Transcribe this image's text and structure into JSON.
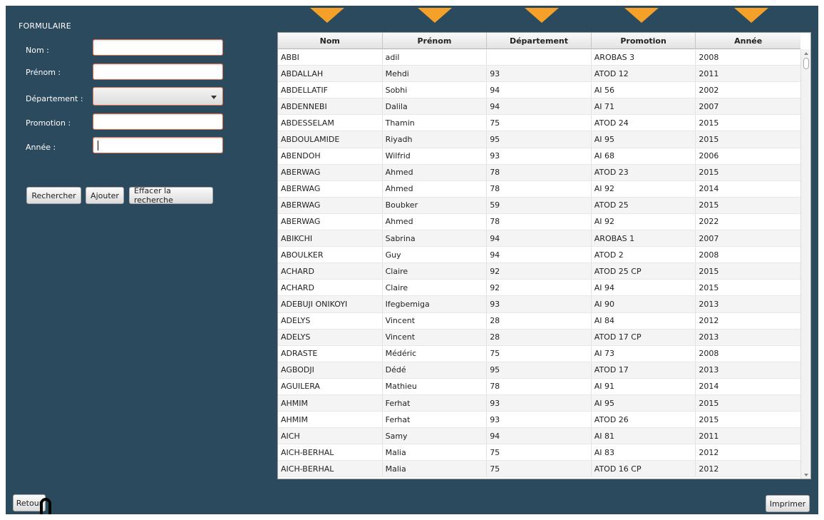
{
  "form": {
    "title": "FORMULAIRE",
    "nom_label": "Nom :",
    "prenom_label": "Prénom :",
    "departement_label": "Département :",
    "promotion_label": "Promotion :",
    "annee_label": "Année :",
    "nom_value": "",
    "prenom_value": "",
    "departement_value": "",
    "promotion_value": "",
    "annee_value": ""
  },
  "buttons": {
    "rechercher": "Rechercher",
    "ajouter": "Ajouter",
    "effacer": "Effacer la recherche",
    "retour": "Retour",
    "imprimer": "Imprimer"
  },
  "table": {
    "columns": [
      "Nom",
      "Prénom",
      "Département",
      "Promotion",
      "Année"
    ],
    "rows": [
      [
        "ABBI",
        "adil",
        "",
        "AROBAS 3",
        "2008"
      ],
      [
        "ABDALLAH",
        "Mehdi",
        "93",
        "ATOD 12",
        "2011"
      ],
      [
        "ABDELLATIF",
        "Sobhi",
        "94",
        "AI 56",
        "2002"
      ],
      [
        "ABDENNEBI",
        "Dalila",
        "94",
        "AI 71",
        "2007"
      ],
      [
        "ABDESSELAM",
        "Thamin",
        "75",
        "ATOD 24",
        "2015"
      ],
      [
        "ABDOULAMIDE",
        "Riyadh",
        "95",
        "AI 95",
        "2015"
      ],
      [
        "ABENDOH",
        "Wilfrid",
        "93",
        "AI 68",
        "2006"
      ],
      [
        "ABERWAG",
        "Ahmed",
        "78",
        "ATOD 23",
        "2015"
      ],
      [
        "ABERWAG",
        "Ahmed",
        "78",
        "AI 92",
        "2014"
      ],
      [
        "ABERWAG",
        "Boubker",
        "59",
        "ATOD 25",
        "2015"
      ],
      [
        "ABERWAG",
        "Ahmed",
        "78",
        "AI 92",
        "2022"
      ],
      [
        "ABIKCHI",
        "Sabrina",
        "94",
        "AROBAS 1",
        "2007"
      ],
      [
        "ABOULKER",
        "Guy",
        "94",
        "ATOD 2",
        "2008"
      ],
      [
        "ACHARD",
        "Claire",
        "92",
        "ATOD 25 CP",
        "2015"
      ],
      [
        "ACHARD",
        "Claire",
        "92",
        "AI 94",
        "2015"
      ],
      [
        "ADEBUJI ONIKOYI",
        "Ifegbemiga",
        "93",
        "AI 90",
        "2013"
      ],
      [
        "ADELYS",
        "Vincent",
        "28",
        "AI 84",
        "2012"
      ],
      [
        "ADELYS",
        "Vincent",
        "28",
        "ATOD 17 CP",
        "2013"
      ],
      [
        "ADRASTE",
        "Médéric",
        "75",
        "AI 73",
        "2008"
      ],
      [
        "AGBODJI",
        "Dédé",
        "95",
        "ATOD 17",
        "2013"
      ],
      [
        "AGUILERA",
        "Mathieu",
        "78",
        "AI 91",
        "2014"
      ],
      [
        "AHMIM",
        "Ferhat",
        "93",
        "AI 95",
        "2015"
      ],
      [
        "AHMIM",
        "Ferhat",
        "93",
        "ATOD 26",
        "2015"
      ],
      [
        "AICH",
        "Samy",
        "94",
        "AI 81",
        "2011"
      ],
      [
        "AICH-BERHAL",
        "Malia",
        "75",
        "AI 83",
        "2012"
      ],
      [
        "AICH-BERHAL",
        "Malia",
        "75",
        "ATOD 16 CP",
        "2012"
      ]
    ]
  },
  "colors": {
    "background": "#2c4a5e",
    "accent_arrows": "#f5a028",
    "focus_border": "#d96c4c"
  }
}
